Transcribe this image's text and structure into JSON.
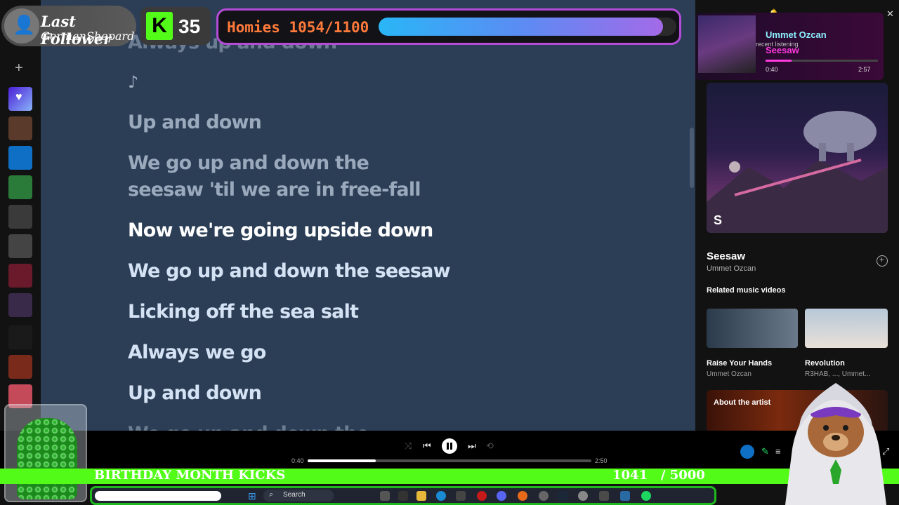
{
  "overlay": {
    "follower_label": "Last Follower",
    "follower_name": "GermanShepard",
    "kick_count": "35",
    "kick_letter": "K",
    "homies_label": "Homies 1054/1100",
    "homies_progress": 0.955,
    "birthday_label": "BIRTHDAY MONTH KICKS",
    "birthday_count": "1041   / 5000"
  },
  "mini_player": {
    "artist": "Ummet Ozcan",
    "subtitle": "recent listening",
    "song": "Seesaw",
    "position": "0:40",
    "duration": "2:57",
    "progress": 0.23
  },
  "lyrics": {
    "lines": [
      {
        "text": "Always up and down",
        "state": "dim"
      },
      {
        "text": "♪",
        "state": "past"
      },
      {
        "text": "Up and down",
        "state": "past"
      },
      {
        "text": "We go up and down the",
        "state": "past"
      },
      {
        "text": "seesaw 'til we are in free-fall",
        "state": "past"
      },
      {
        "text": "Now we're going upside down",
        "state": "current"
      },
      {
        "text": "We go up and down the seesaw",
        "state": "future"
      },
      {
        "text": "Licking off the sea salt",
        "state": "future"
      },
      {
        "text": "Always we go",
        "state": "future"
      },
      {
        "text": "Up and down",
        "state": "future"
      },
      {
        "text": "We go up and down the",
        "state": "dim"
      }
    ]
  },
  "now_playing": {
    "title": "Seesaw",
    "artist": "Ummet Ozcan",
    "related_heading": "Related music videos",
    "videos": [
      {
        "title": "Raise Your Hands",
        "artist": "Ummet Ozcan"
      },
      {
        "title": "Revolution",
        "artist": "R3HAB, ..., Ummet..."
      }
    ],
    "about_label": "About the artist"
  },
  "player": {
    "elapsed": "0:40",
    "duration": "2:50",
    "progress": 0.24
  },
  "taskbar": {
    "search_label": "Search"
  },
  "colors": {
    "lyrics_bg": "#2b3e56",
    "kick_green": "#53fc18",
    "homies_border": "#b44cd8",
    "homies_text": "#ff7a3a"
  }
}
